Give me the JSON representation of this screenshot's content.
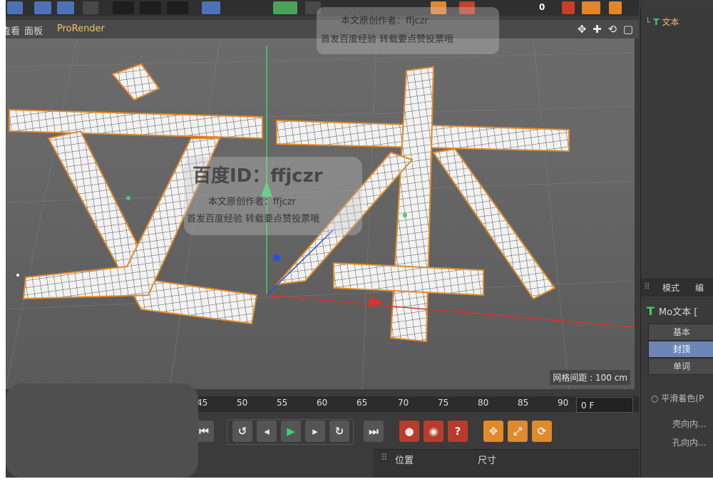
{
  "toolbar": {
    "frame_number": "0"
  },
  "viewport_menu": {
    "items": [
      "査看",
      "面板",
      "ProRender"
    ]
  },
  "viewport": {
    "grid_spacing": "网格间距 : 100 cm",
    "text_3d": "文本"
  },
  "object_manager": {
    "item_label": "文本"
  },
  "attributes": {
    "menu": [
      "模式",
      "编"
    ],
    "title": "Mo文本 [",
    "tabs": [
      "基本",
      "封顶",
      "单词"
    ],
    "active_tab": "封顶",
    "rows": [
      "平滑着色(P",
      "壳向内...",
      "孔向内..."
    ]
  },
  "timeline": {
    "ticks": [
      "45",
      "50",
      "55",
      "60",
      "65",
      "70",
      "75",
      "80",
      "85",
      "90"
    ],
    "current_frame": "0 F"
  },
  "coordinates": {
    "position_label": "位置",
    "size_label": "尺寸"
  },
  "watermark": {
    "lines": [
      "百度ID：ffjczr",
      "本文原创作者：ffjczr",
      "首发百度经验 转载要点赞投票哦"
    ]
  },
  "colors": {
    "accent": "#f0c060",
    "selection": "#6d86b5",
    "mesh_outline": "#e08a2a"
  }
}
